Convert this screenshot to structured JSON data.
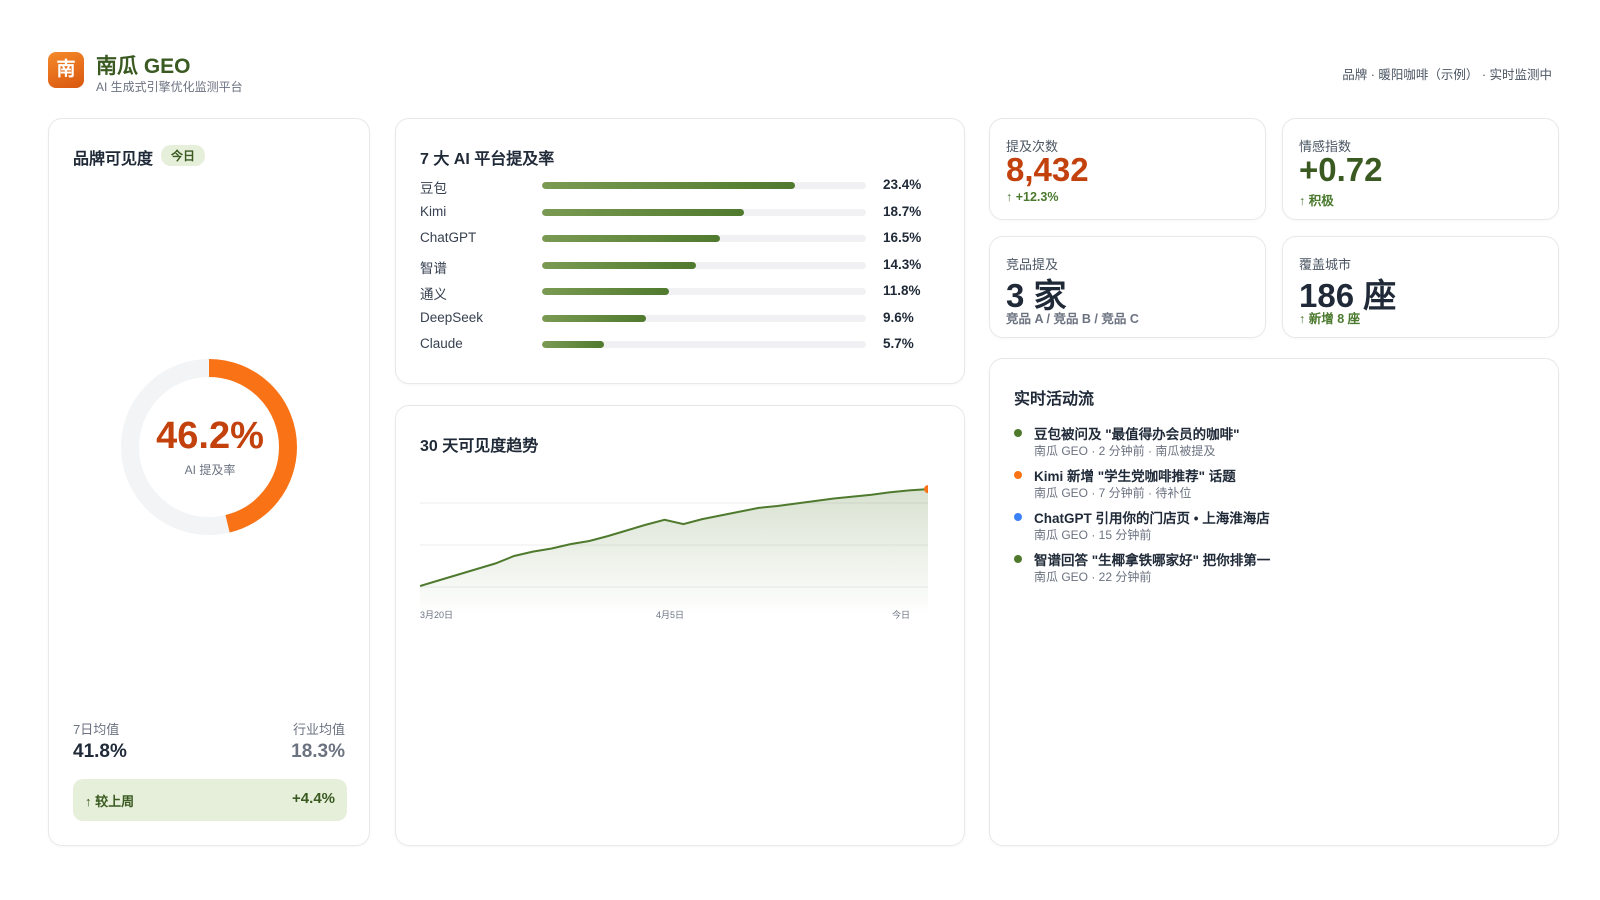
{
  "header": {
    "logo_char": "南",
    "title": "南瓜 GEO",
    "subtitle": "AI 生成式引擎优化监测平台",
    "right_text": "品牌 · 暖阳咖啡（示例） · 实时监测中"
  },
  "visibility": {
    "title": "品牌可见度",
    "badge": "今日",
    "value": "46.2%",
    "value_fraction": 0.462,
    "value_label": "AI 提及率",
    "avg7_label": "7日均值",
    "avg7_value": "41.8%",
    "industry_label": "行业均值",
    "industry_value": "18.3%",
    "wow_label": "↑ 较上周",
    "wow_value": "+4.4%"
  },
  "platforms": {
    "title": "7 大 AI 平台提及率",
    "items": [
      {
        "name": "豆包",
        "pct_label": "23.4%",
        "pct": 23.4
      },
      {
        "name": "Kimi",
        "pct_label": "18.7%",
        "pct": 18.7
      },
      {
        "name": "ChatGPT",
        "pct_label": "16.5%",
        "pct": 16.5
      },
      {
        "name": "智谱",
        "pct_label": "14.3%",
        "pct": 14.3
      },
      {
        "name": "通义",
        "pct_label": "11.8%",
        "pct": 11.8
      },
      {
        "name": "DeepSeek",
        "pct_label": "9.6%",
        "pct": 9.6
      },
      {
        "name": "Claude",
        "pct_label": "5.7%",
        "pct": 5.7
      }
    ]
  },
  "trend": {
    "title": "30 天可见度趋势"
  },
  "chart_data": {
    "type": "area",
    "title": "30 天可见度趋势",
    "x_ticks": [
      "3月20日",
      "4月5日",
      "今日"
    ],
    "series": [
      {
        "values": [
          0.0,
          0.09,
          0.18,
          0.27,
          0.36,
          0.48,
          0.55,
          0.6,
          0.67,
          0.72,
          0.8,
          0.89,
          0.98,
          1.06,
          0.99,
          1.07,
          1.13,
          1.19,
          1.25,
          1.28,
          1.32,
          1.36,
          1.4,
          1.43,
          1.46,
          1.5,
          1.53,
          1.55
        ]
      }
    ],
    "grid": true
  },
  "kpis": {
    "mentions": {
      "label": "提及次数",
      "value": "8,432",
      "sub": "↑ +12.3%",
      "color": "#c2410c"
    },
    "sentiment": {
      "label": "情感指数",
      "value": "+0.72",
      "sub": "↑ 积极",
      "color": "#3a5a22"
    },
    "competitors": {
      "label": "竞品提及",
      "value": "3 家",
      "sub": "竞品 A / 竞品 B / 竞品 C"
    },
    "cities": {
      "label": "覆盖城市",
      "value": "186 座",
      "sub": "↑ 新增 8 座"
    }
  },
  "activity": {
    "title": "实时活动流",
    "items": [
      {
        "title": "豆包被问及 \"最值得办会员的咖啡\"",
        "meta": "南瓜 GEO · 2 分钟前 · 南瓜被提及",
        "dot_color": "#4f7a2e"
      },
      {
        "title": "Kimi 新增 \"学生党咖啡推荐\" 话题",
        "meta": "南瓜 GEO · 7 分钟前 · 待补位",
        "dot_color": "#f97316"
      },
      {
        "title": "ChatGPT 引用你的门店页 • 上海淮海店",
        "meta": "南瓜 GEO · 15 分钟前",
        "dot_color": "#3b82f6"
      },
      {
        "title": "智谱回答 \"生椰拿铁哪家好\" 把你排第一",
        "meta": "南瓜 GEO · 22 分钟前",
        "dot_color": "#4f7a2e"
      }
    ]
  },
  "colors": {
    "accent_orange": "#f97316",
    "accent_green": "#4f7a2e",
    "donut_track": "#f3f4f6"
  }
}
